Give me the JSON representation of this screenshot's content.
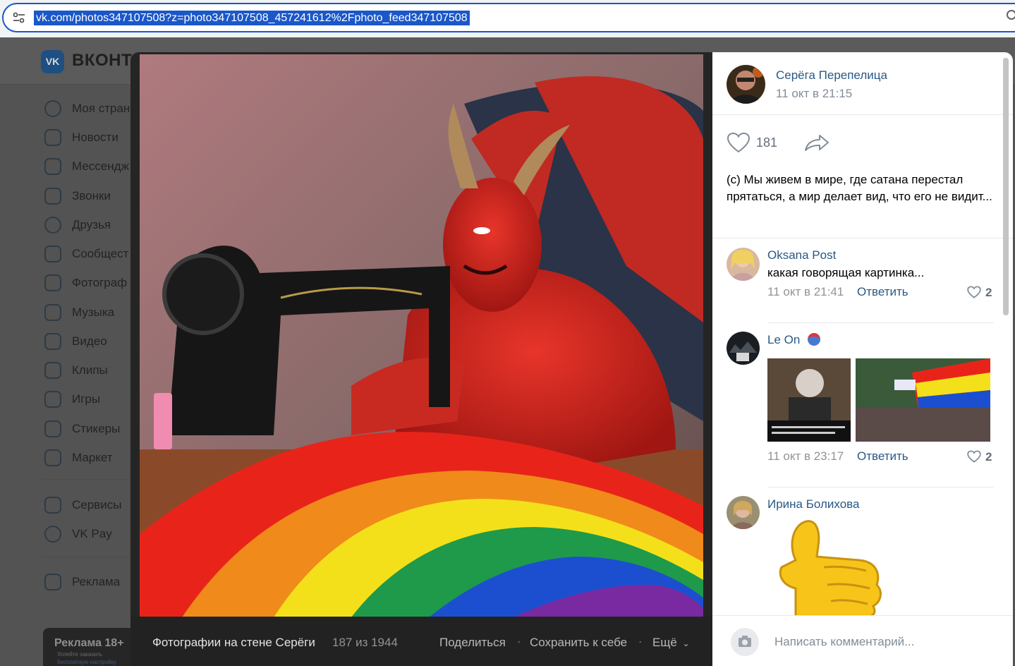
{
  "browser": {
    "url": "vk.com/photos347107508?z=photo347107508_457241612%2Fphoto_feed347107508"
  },
  "vk": {
    "logo_text": "VK",
    "brand": "ВКОНТА",
    "sidebar": [
      {
        "label": "Моя стран",
        "icon": "profile-icon"
      },
      {
        "label": "Новости",
        "icon": "news-icon"
      },
      {
        "label": "Мессендж",
        "icon": "messenger-icon"
      },
      {
        "label": "Звонки",
        "icon": "phone-icon"
      },
      {
        "label": "Друзья",
        "icon": "friends-icon"
      },
      {
        "label": "Сообщест",
        "icon": "communities-icon"
      },
      {
        "label": "Фотограф",
        "icon": "photos-icon"
      },
      {
        "label": "Музыка",
        "icon": "music-icon"
      },
      {
        "label": "Видео",
        "icon": "video-icon"
      },
      {
        "label": "Клипы",
        "icon": "clips-icon"
      },
      {
        "label": "Игры",
        "icon": "games-icon"
      },
      {
        "label": "Стикеры",
        "icon": "stickers-icon"
      },
      {
        "label": "Маркет",
        "icon": "market-icon"
      },
      {
        "label": "Сервисы",
        "icon": "services-icon"
      },
      {
        "label": "VK Pay",
        "icon": "vkpay-icon"
      },
      {
        "label": "Реклама",
        "icon": "ads-icon"
      }
    ],
    "ad_block": {
      "title": "Реклама 18+",
      "sub1": "Успейте заказать",
      "sub2": "бесплатную настройку"
    }
  },
  "viewer": {
    "album_label": "Фотографии на стене Серёги",
    "counter": "187 из 1944",
    "share_label": "Поделиться",
    "save_label": "Сохранить к себе",
    "more_label": "Ещё",
    "separator": "·"
  },
  "post": {
    "author": "Серёга Перепелица",
    "date": "11 окт в 21:15",
    "likes": "181",
    "caption": "(с) Мы живем в мире, где сатана перестал прятаться, а мир делает вид, что его не видит..."
  },
  "comments": [
    {
      "name": "Oksana Post",
      "text": "какая говорящая картинка...",
      "date": "11 окт в 21:41",
      "reply": "Ответить",
      "likes": "2"
    },
    {
      "name": "Le On",
      "text": "",
      "date": "11 окт в 23:17",
      "reply": "Ответить",
      "likes": "2"
    },
    {
      "name": "Ирина Болихова",
      "text": "",
      "date": "",
      "reply": "",
      "likes": ""
    }
  ],
  "composer": {
    "placeholder": "Написать комментарий..."
  },
  "colors": {
    "accent_blue": "#2a5885",
    "url_highlight": "#1a57c9"
  }
}
